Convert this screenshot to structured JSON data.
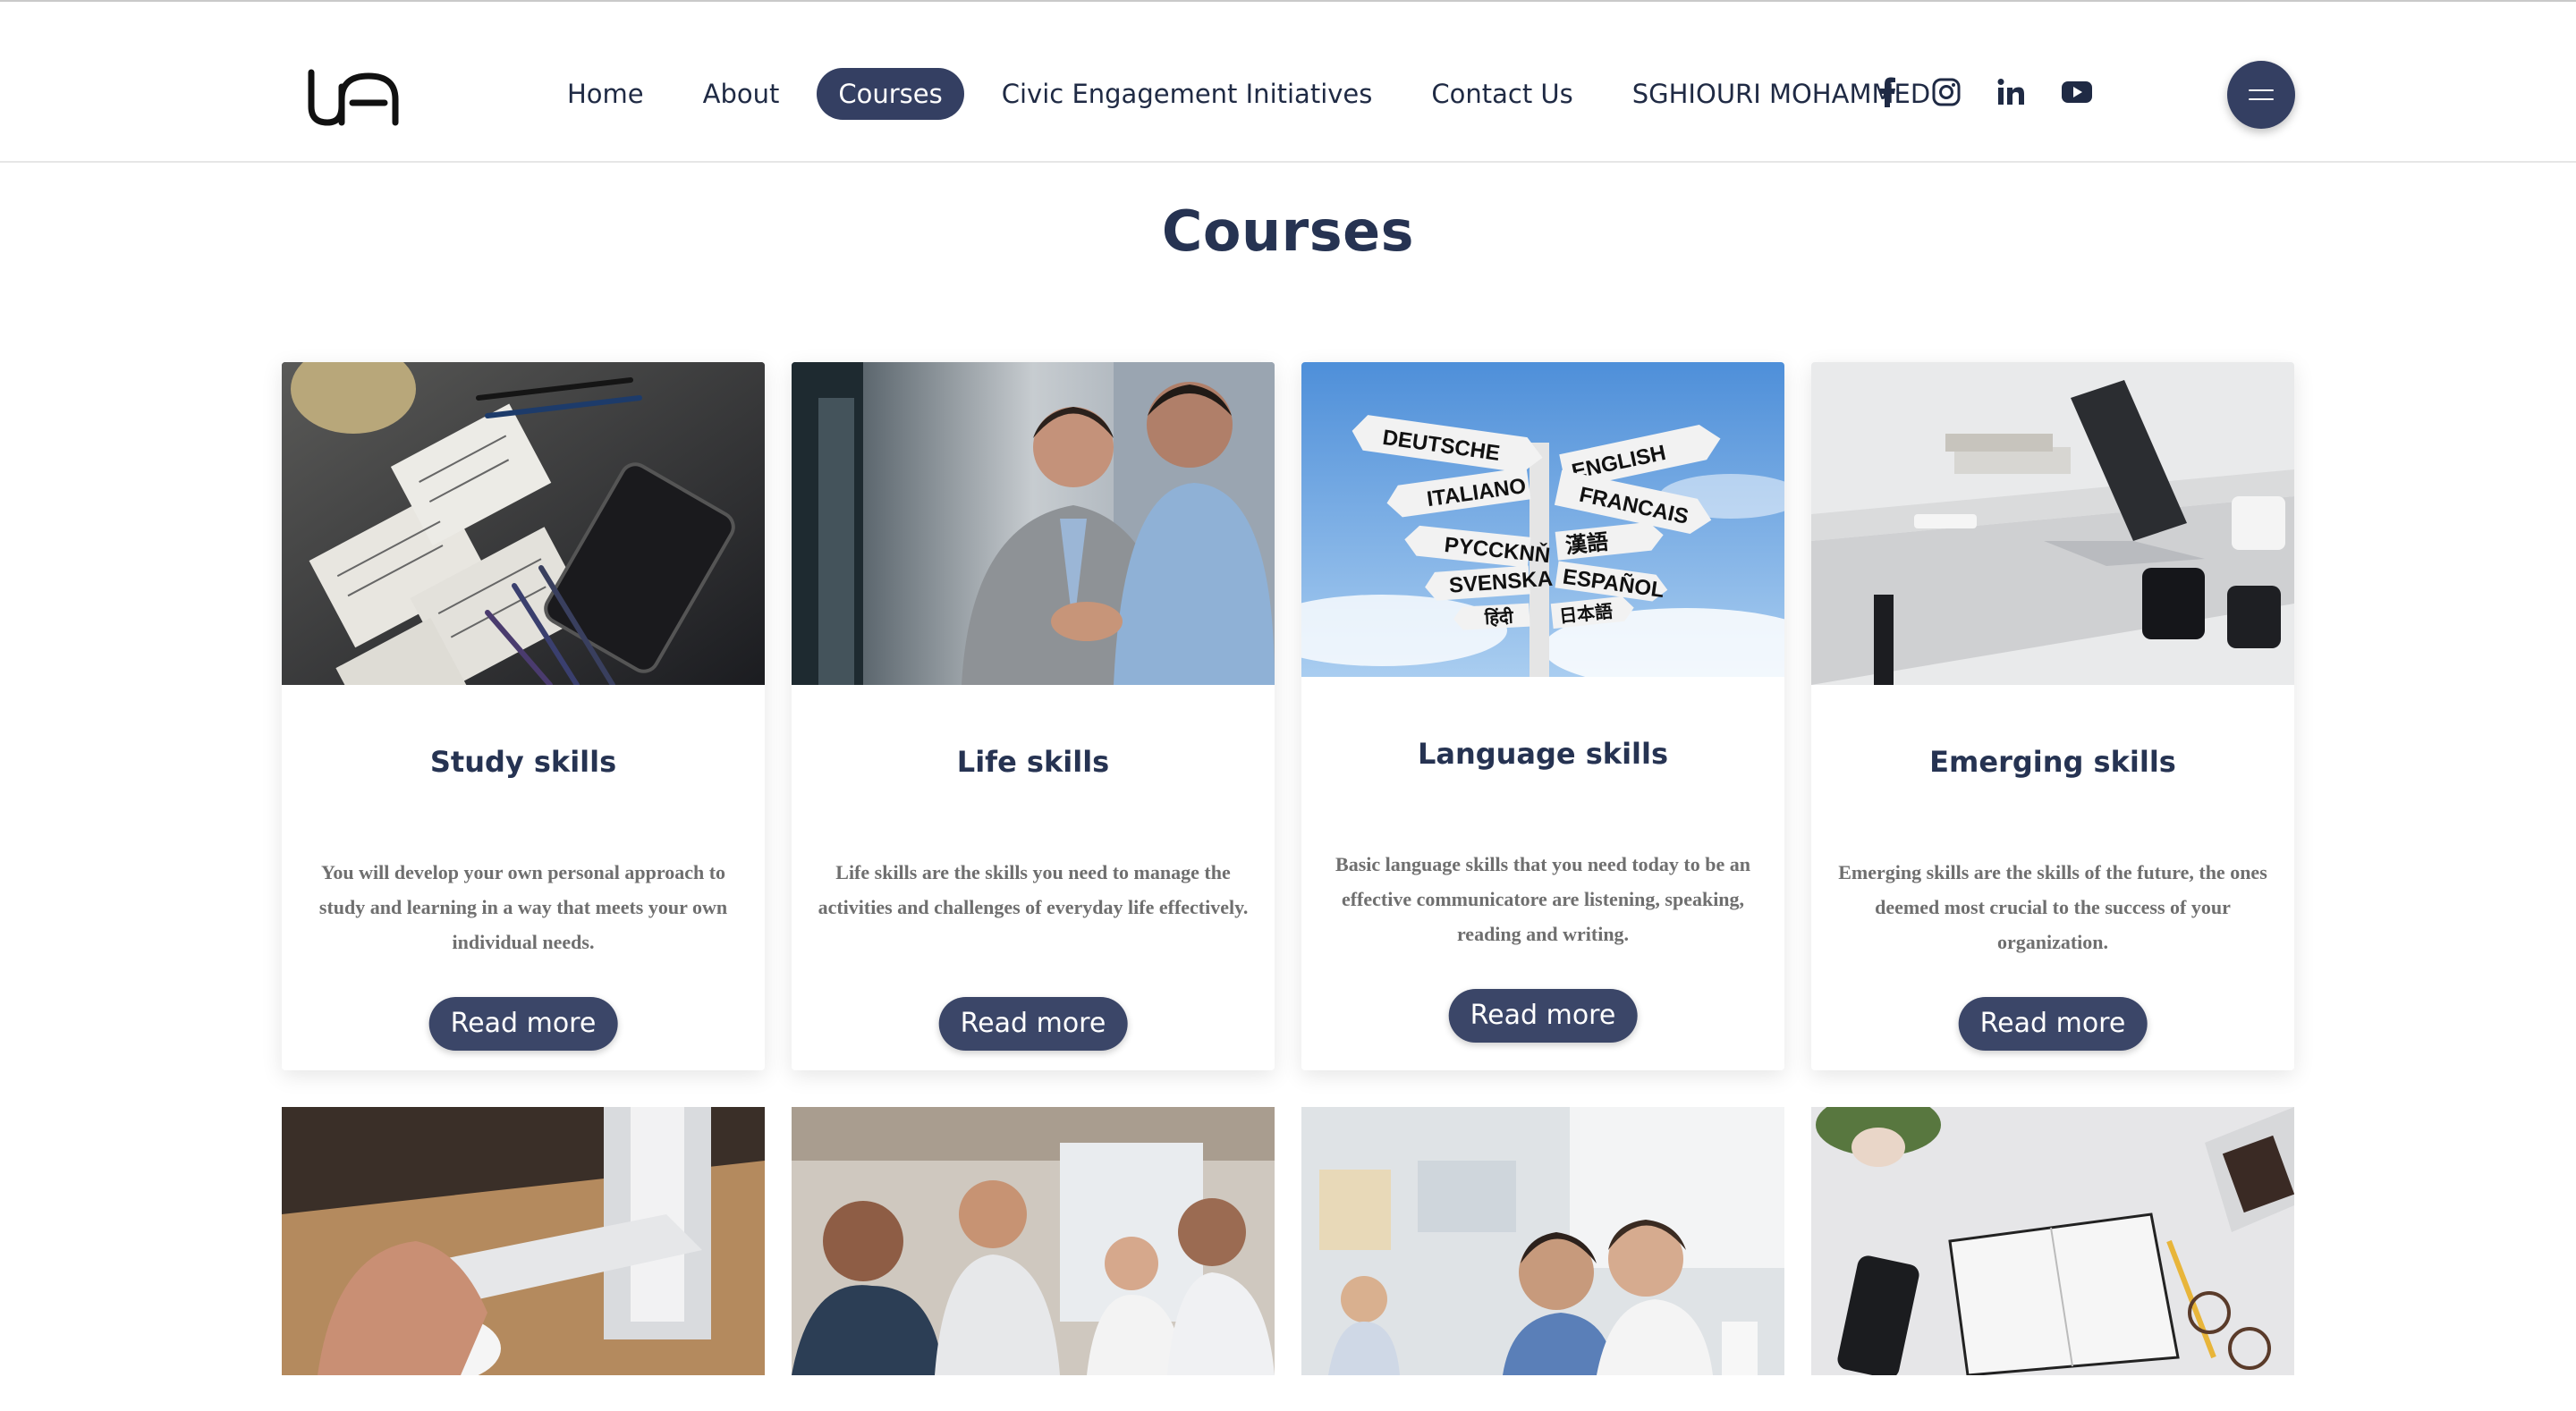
{
  "header": {
    "logo_text": "UA",
    "nav": [
      {
        "label": "Home",
        "active": false
      },
      {
        "label": "About",
        "active": false
      },
      {
        "label": "Courses",
        "active": true
      },
      {
        "label": "Civic Engagement Initiatives",
        "active": false
      },
      {
        "label": "Contact Us",
        "active": false
      },
      {
        "label": "SGHIOURI MOHAMMED",
        "active": false
      }
    ],
    "social": [
      "facebook-icon",
      "instagram-icon",
      "linkedin-icon",
      "youtube-icon"
    ],
    "menu_icon": "hamburger-icon"
  },
  "page": {
    "title": "Courses"
  },
  "cards": [
    {
      "title": "Study skills",
      "text": "You will develop your own personal approach to study and learning in a way that meets your own individual needs.",
      "button": "Read more",
      "image": "desk-with-notes-and-pencils"
    },
    {
      "title": "Life skills",
      "text": "Life skills are the skills you need to manage the activities and challenges of everyday life effectively.",
      "button": "Read more",
      "image": "business-handshake"
    },
    {
      "title": "Language skills",
      "text": "Basic language skills that you need today to be an effective communicatore are listening, speaking, reading and writing.",
      "button": "Read more",
      "image": "language-signpost",
      "signs": [
        "DEUTSCHE",
        "ENGLISH",
        "ITALIANO",
        "FRANCAIS",
        "PYCCKNŇ",
        "漢語",
        "SVENSKA",
        "ESPAÑOL",
        "हिंदी",
        "日本語"
      ]
    },
    {
      "title": "Emerging skills",
      "text": "Emerging skills are the skills of the future, the ones deemed most crucial to the success of your organization.",
      "button": "Read more",
      "image": "laptop-on-desk"
    }
  ],
  "row2_images": [
    "hand-on-mouse",
    "team-meeting",
    "students-in-classroom",
    "notebook-on-desk"
  ],
  "colors": {
    "primary": "#343f62",
    "heading": "#263352",
    "body_text": "#6f6f6f"
  }
}
